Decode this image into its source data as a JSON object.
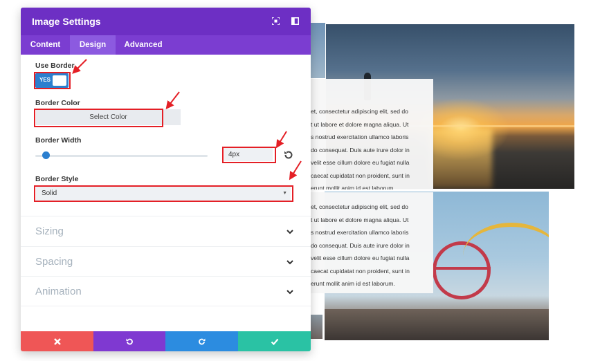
{
  "modal": {
    "title": "Image Settings",
    "header_icons": [
      "expand-icon",
      "sidebar-toggle-icon"
    ],
    "tabs": [
      {
        "label": "Content",
        "active": false
      },
      {
        "label": "Design",
        "active": true
      },
      {
        "label": "Advanced",
        "active": false
      }
    ],
    "fields": {
      "use_border": {
        "label": "Use Border",
        "value": "YES"
      },
      "border_color": {
        "label": "Border Color",
        "button": "Select Color"
      },
      "border_width": {
        "label": "Border Width",
        "value": "4px",
        "slider_fraction": 0.06
      },
      "border_style": {
        "label": "Border Style",
        "value": "Solid"
      }
    },
    "sections": [
      {
        "label": "Sizing"
      },
      {
        "label": "Spacing"
      },
      {
        "label": "Animation"
      }
    ],
    "footer": [
      {
        "name": "cancel-button",
        "icon": "close-icon",
        "color": "#ef5656"
      },
      {
        "name": "undo-button",
        "icon": "undo-icon",
        "color": "#7f39d1"
      },
      {
        "name": "redo-button",
        "icon": "redo-icon",
        "color": "#2c8ce0"
      },
      {
        "name": "save-button",
        "icon": "check-icon",
        "color": "#2ac2a4"
      }
    ]
  },
  "colors": {
    "header": "#6d2fc4",
    "tabs": "#7b3dd1",
    "accent": "#2b7fcf",
    "annotation": "#e41f26"
  },
  "background": {
    "lorem_1": "et, consectetur adipiscing elit, sed do\nt ut labore et dolore magna aliqua. Ut\ns nostrud exercitation ullamco laboris\ndo consequat. Duis aute irure dolor in\nvelit esse cillum dolore eu fugiat nulla\ncaecat cupidatat non proident, sunt in\nerunt mollit anim id est laborum.",
    "lorem_2": "et, consectetur adipiscing elit, sed do\nt ut labore et dolore magna aliqua. Ut\ns nostrud exercitation ullamco laboris\ndo consequat. Duis aute irure dolor in\nvelit esse cillum dolore eu fugiat nulla\ncaecat cupidatat non proident, sunt in\nerunt mollit anim id est laborum."
  }
}
